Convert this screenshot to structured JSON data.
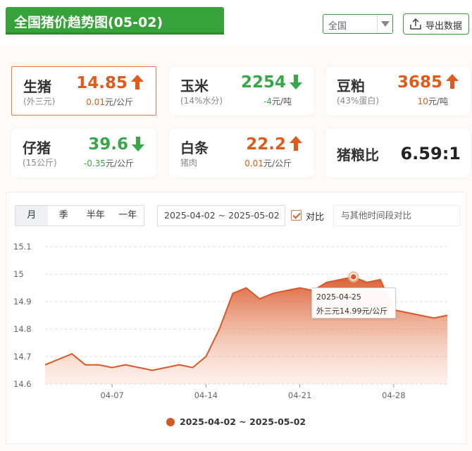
{
  "header": {
    "title": "全国猪价趋势图(05-02)",
    "region": "全国",
    "export_label": "导出数据"
  },
  "cards": [
    {
      "name": "生猪",
      "sub": "(外三元)",
      "price": "14.85",
      "direction": "up",
      "change": "0.01",
      "unit": "元/公斤"
    },
    {
      "name": "玉米",
      "sub": "(14%水分)",
      "price": "2254",
      "direction": "down",
      "change": "-4",
      "unit": "元/吨"
    },
    {
      "name": "豆粕",
      "sub": "(43%蛋白)",
      "price": "3685",
      "direction": "up",
      "change": "10",
      "unit": "元/吨"
    },
    {
      "name": "仔猪",
      "sub": "(15公斤)",
      "price": "39.6",
      "direction": "down",
      "change": "-0.35",
      "unit": "元/公斤"
    },
    {
      "name": "白条",
      "sub": "猪肉",
      "price": "22.2",
      "direction": "up",
      "change": "0.01",
      "unit": "元/公斤"
    },
    {
      "name": "猪粮比",
      "ratio": "6.59:1"
    }
  ],
  "controls": {
    "periods": [
      "月",
      "季",
      "半年",
      "一年"
    ],
    "active_period": "月",
    "date_range": "2025-04-02 ~ 2025-05-02",
    "compare_label": "对比",
    "compare_checked": true,
    "compare_placeholder": "与其他时间段对比"
  },
  "colors": {
    "brand_green": "#37a13a",
    "up_red": "#e05a1c",
    "down_green": "#3aa64a",
    "series": "#d45a25"
  },
  "chart_data": {
    "type": "area",
    "x": [
      "04-02",
      "04-03",
      "04-04",
      "04-05",
      "04-06",
      "04-07",
      "04-08",
      "04-09",
      "04-10",
      "04-11",
      "04-12",
      "04-13",
      "04-14",
      "04-15",
      "04-16",
      "04-17",
      "04-18",
      "04-19",
      "04-20",
      "04-21",
      "04-22",
      "04-23",
      "04-24",
      "04-25",
      "04-26",
      "04-27",
      "04-28",
      "04-29",
      "04-30",
      "05-01",
      "05-02"
    ],
    "series": [
      {
        "name": "2025-04-02 ~ 2025-05-02",
        "values": [
          14.67,
          14.69,
          14.71,
          14.67,
          14.67,
          14.66,
          14.67,
          14.66,
          14.65,
          14.66,
          14.67,
          14.66,
          14.7,
          14.8,
          14.93,
          14.95,
          14.91,
          14.93,
          14.94,
          14.95,
          14.94,
          14.97,
          14.98,
          14.99,
          14.97,
          14.98,
          14.87,
          14.86,
          14.85,
          14.84,
          14.85
        ]
      }
    ],
    "xticks": [
      "04-07",
      "04-14",
      "04-21",
      "04-28"
    ],
    "yticks": [
      14.6,
      14.7,
      14.8,
      14.9,
      15,
      15.1
    ],
    "ylim": [
      14.6,
      15.1
    ],
    "grid": true,
    "legend": "bottom",
    "tooltip": {
      "date": "2025-04-25",
      "text": "外三元14.99元/公斤"
    }
  }
}
